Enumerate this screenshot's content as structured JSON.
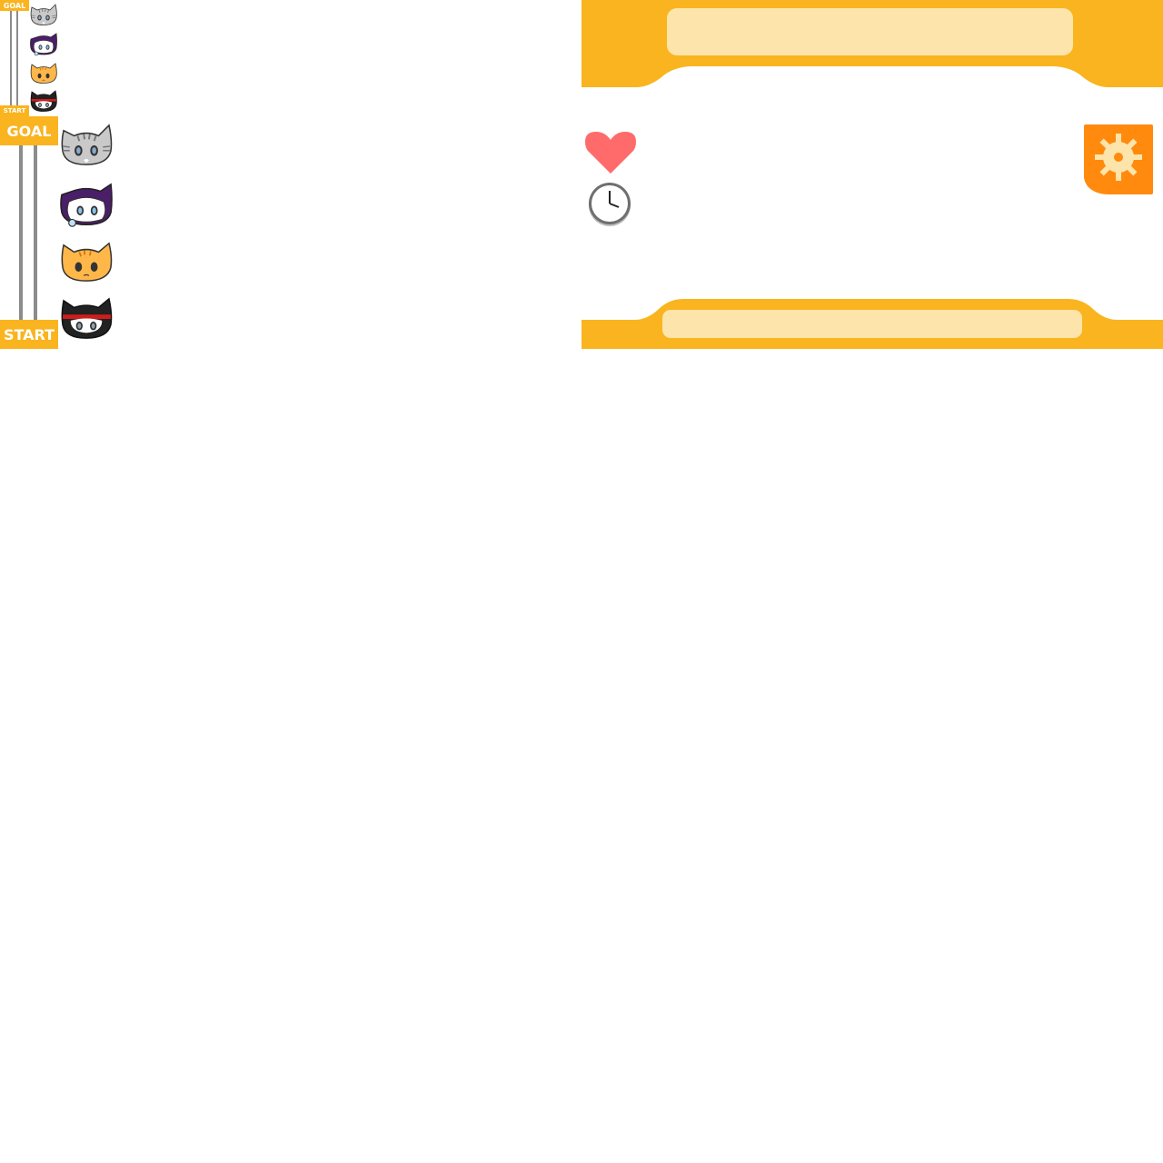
{
  "progress_small": {
    "goal_label": "GOAL",
    "start_label": "START",
    "characters": [
      "gray-tabby-cat",
      "purple-hood-cat",
      "orange-tabby-cat",
      "black-ninja-cat"
    ]
  },
  "progress_large": {
    "goal_label": "GOAL",
    "start_label": "START",
    "characters": [
      "gray-tabby-cat",
      "purple-hood-cat",
      "orange-tabby-cat",
      "black-ninja-cat"
    ]
  },
  "hud": {
    "top_banner_text": "",
    "bottom_banner_text": "",
    "icons": {
      "life": "heart-icon",
      "time": "clock-icon",
      "settings": "gear-icon"
    }
  },
  "colors": {
    "banner": "#f9b41f",
    "banner_field": "#fde4aa",
    "settings_button": "#ff8a0d",
    "heart": "#ff6b6b",
    "rail": "#8c8c8c"
  }
}
